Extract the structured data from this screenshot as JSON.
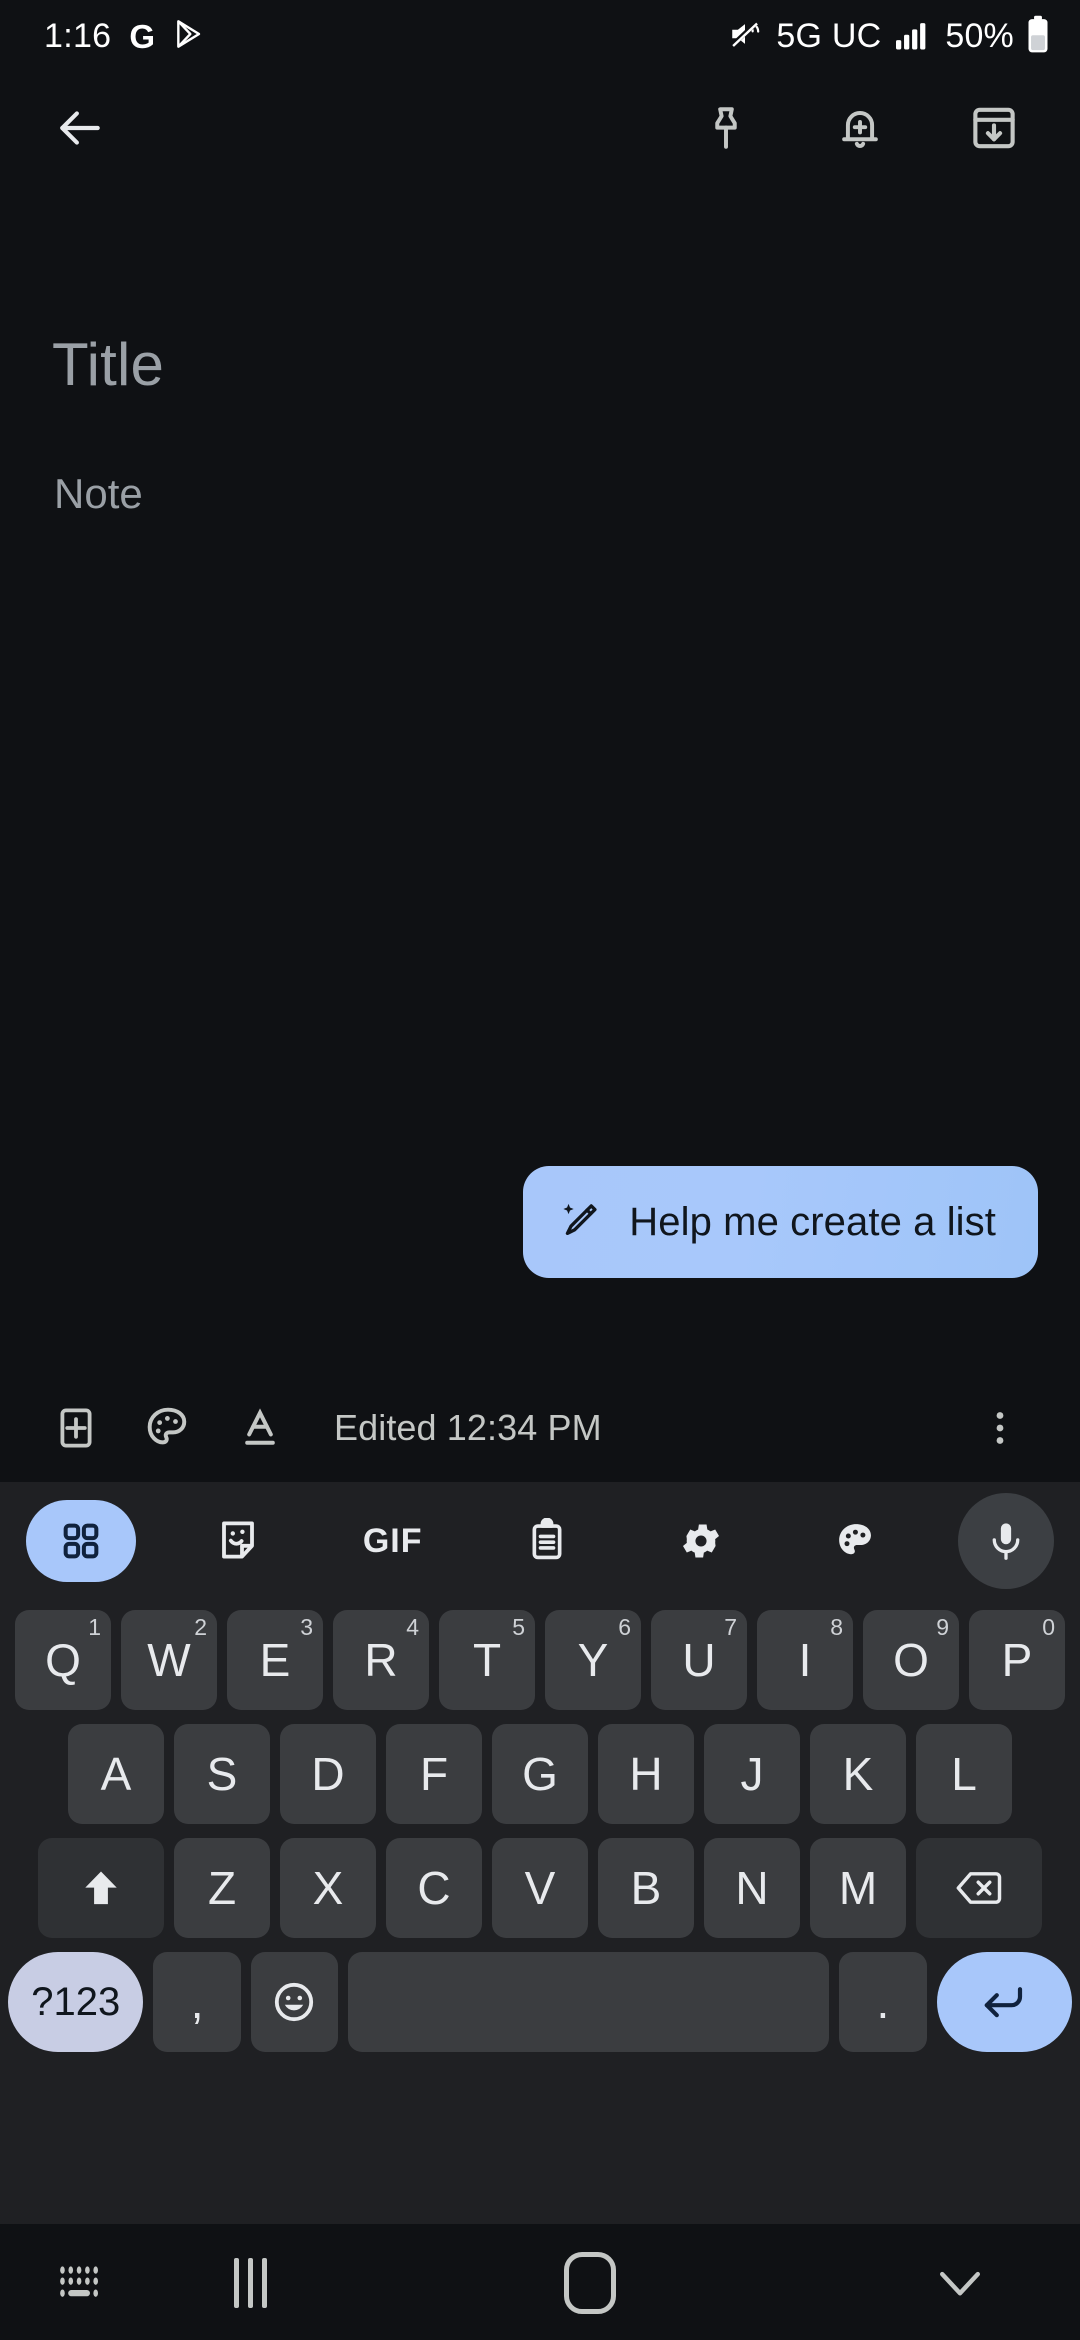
{
  "status_bar": {
    "time": "1:16",
    "left_icons": [
      "google-g-icon",
      "play-store-icon"
    ],
    "network": "5G UC",
    "battery_percent": "50%",
    "right_icons": [
      "mute-icon",
      "signal-bars-icon",
      "battery-icon"
    ]
  },
  "app_bar": {
    "back_label": "back-arrow",
    "actions": [
      {
        "name": "pin-icon",
        "label": "Pin note"
      },
      {
        "name": "reminder-bell-icon",
        "label": "Add reminder"
      },
      {
        "name": "archive-icon",
        "label": "Archive"
      }
    ]
  },
  "note": {
    "title_placeholder": "Title",
    "body_placeholder": "Note"
  },
  "ai_chip": {
    "label": "Help me create a list",
    "icon": "magic-wand-icon",
    "gradient_start": "#a8c7fa",
    "gradient_end": "#9ec4f8",
    "text_color": "#10161d"
  },
  "note_toolbar": {
    "edited_text": "Edited 12:34 PM",
    "buttons": [
      {
        "name": "add-box-icon",
        "label": "Add"
      },
      {
        "name": "palette-icon",
        "label": "Background options"
      },
      {
        "name": "text-format-icon",
        "label": "Formatting options"
      }
    ],
    "overflow": {
      "name": "more-vert-icon",
      "label": "More"
    }
  },
  "keyboard": {
    "toolbar": [
      {
        "name": "grid-apps-icon",
        "label": "Toolbar",
        "active": true
      },
      {
        "name": "sticker-icon",
        "label": "Stickers",
        "active": false
      },
      {
        "name": "gif-icon",
        "label": "GIF",
        "active": false
      },
      {
        "name": "clipboard-icon",
        "label": "Clipboard",
        "active": false
      },
      {
        "name": "settings-gear-icon",
        "label": "Settings",
        "active": false
      },
      {
        "name": "theme-palette-icon",
        "label": "Themes",
        "active": false
      },
      {
        "name": "microphone-icon",
        "label": "Voice input",
        "active": false
      }
    ],
    "row1": [
      {
        "key": "Q",
        "sup": "1"
      },
      {
        "key": "W",
        "sup": "2"
      },
      {
        "key": "E",
        "sup": "3"
      },
      {
        "key": "R",
        "sup": "4"
      },
      {
        "key": "T",
        "sup": "5"
      },
      {
        "key": "Y",
        "sup": "6"
      },
      {
        "key": "U",
        "sup": "7"
      },
      {
        "key": "I",
        "sup": "8"
      },
      {
        "key": "O",
        "sup": "9"
      },
      {
        "key": "P",
        "sup": "0"
      }
    ],
    "row2": [
      "A",
      "S",
      "D",
      "F",
      "G",
      "H",
      "J",
      "K",
      "L"
    ],
    "row3": [
      "Z",
      "X",
      "C",
      "V",
      "B",
      "N",
      "M"
    ],
    "shift_icon": "shift-up-arrow-icon",
    "backspace_icon": "backspace-icon",
    "symbols_key": "?123",
    "comma_key": ",",
    "emoji_icon": "emoji-smiley-icon",
    "space_key": "",
    "period_key": ".",
    "enter_icon": "enter-return-icon",
    "key_bg": "#3b3d40",
    "special_key_bg": "#2f3134",
    "accent": "#a8c7fa"
  },
  "nav_bar": {
    "items": [
      {
        "name": "keyboard-switch-icon",
        "label": "Change keyboard"
      },
      {
        "name": "recents-icon",
        "label": "Recent apps"
      },
      {
        "name": "home-icon",
        "label": "Home"
      },
      {
        "name": "hide-keyboard-chevron-icon",
        "label": "Hide keyboard"
      }
    ]
  }
}
